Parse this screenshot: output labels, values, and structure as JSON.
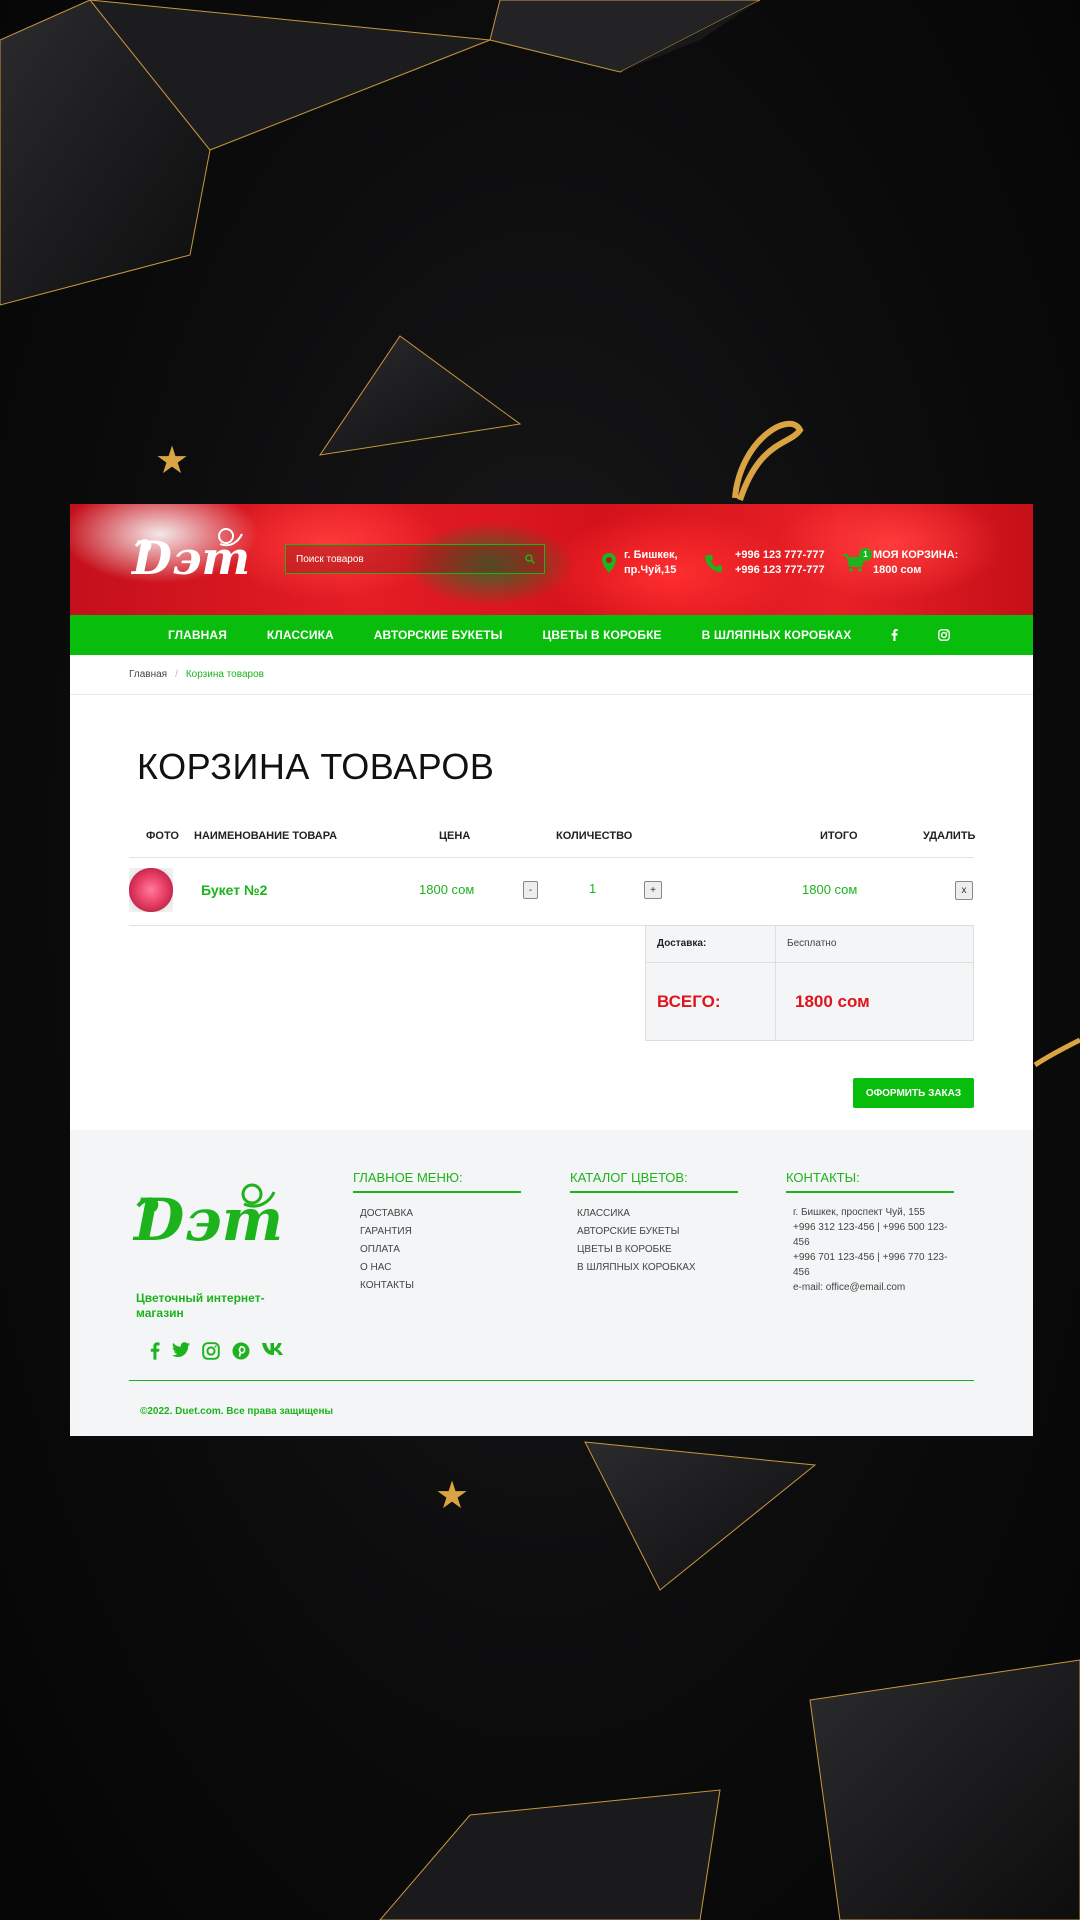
{
  "header": {
    "search_placeholder": "Поиск товаров",
    "address_line1": "г. Бишкек,",
    "address_line2": "пр.Чуй,15",
    "phone1": "+996 123 777-777",
    "phone2": "+996 123 777-777",
    "cart_label": "МОЯ КОРЗИНА:",
    "cart_total": "1800 сом",
    "cart_count": "1"
  },
  "nav": {
    "items": [
      "ГЛАВНАЯ",
      "КЛАССИКА",
      "АВТОРСКИЕ БУКЕТЫ",
      "ЦВЕТЫ В КОРОБКЕ",
      "В ШЛЯПНЫХ КОРОБКАХ"
    ],
    "social_icons": [
      "facebook-icon",
      "instagram-icon"
    ]
  },
  "breadcrumb": {
    "home": "Главная",
    "current": "Корзина товаров"
  },
  "page_title": "КОРЗИНА ТОВАРОВ",
  "table": {
    "headers": {
      "photo": "ФОТО",
      "name": "НАИМЕНОВАНИЕ ТОВАРА",
      "price": "ЦЕНА",
      "qty": "КОЛИЧЕСТВО",
      "total": "ИТОГО",
      "delete": "УДАЛИТЬ"
    },
    "rows": [
      {
        "name": "Букет №2",
        "price": "1800 сом",
        "minus": "-",
        "qty": "1",
        "plus": "+",
        "total": "1800 сом",
        "delete": "x"
      }
    ]
  },
  "summary": {
    "delivery_label": "Доставка:",
    "delivery_value": "Бесплатно",
    "total_label": "ВСЕГО:",
    "total_value": "1800 сом"
  },
  "order_button": "ОФОРМИТЬ ЗАКАЗ",
  "footer": {
    "tagline": "Цветочный интернет-магазин",
    "menu_title": "ГЛАВНОЕ МЕНЮ:",
    "menu_items": [
      "ДОСТАВКА",
      "ГАРАНТИЯ",
      "ОПЛАТА",
      "О НАС",
      "КОНТАКТЫ"
    ],
    "catalog_title": "КАТАЛОГ ЦВЕТОВ:",
    "catalog_items": [
      "КЛАССИКА",
      "АВТОРСКИЕ БУКЕТЫ",
      "ЦВЕТЫ В КОРОБКЕ",
      "В ШЛЯПНЫХ КОРОБКАХ"
    ],
    "contacts_title": "КОНТАКТЫ:",
    "contacts_lines": [
      "г. Бишкек, проспект Чуй, 155",
      "+996 312 123-456 | +996 500 123-456",
      "+996 701 123-456 | +996 770 123-456",
      "e-mail: office@email.com"
    ],
    "social_icons": [
      "facebook-icon",
      "twitter-icon",
      "instagram-icon",
      "pinterest-icon",
      "vk-icon"
    ],
    "copyright": "©2022. Duet.com. Все права защищены"
  },
  "colors": {
    "accent": "#08bd0c",
    "text_green": "#1db31d",
    "total_red": "#e0141c"
  }
}
